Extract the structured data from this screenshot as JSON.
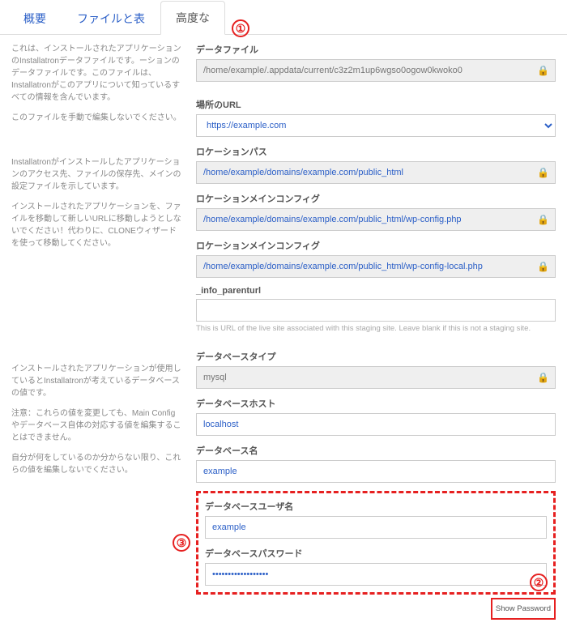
{
  "tabs": {
    "overview": "概要",
    "files": "ファイルと表",
    "advanced": "高度な"
  },
  "annotations": {
    "a1": "①",
    "a2": "②",
    "a3": "③"
  },
  "sidebar": {
    "block1": {
      "p1": "これは、インストールされたアプリケーションのInstallatronデータファイルです。ーションのデータファイルです。このファイルは、Installatronがこのアプリについて知っているすべての情報を含んでいます。",
      "p2": "このファイルを手動で編集しないでください。"
    },
    "block2": {
      "p1": "Installatronがインストールしたアプリケーションのアクセス先、ファイルの保存先、メインの設定ファイルを示しています。",
      "p2": "インストールされたアプリケーションを、ファイルを移動して新しいURLに移動しようとしないでください！代わりに、CLONEウィザードを使って移動してください。"
    },
    "block3": {
      "p1": "インストールされたアプリケーションが使用しているとInstallatronが考えているデータベースの値です。",
      "p2": "注意：これらの値を変更しても、Main Configやデータベース自体の対応する値を編集することはできません。",
      "p3": "自分が何をしているのか分からない限り、これらの値を編集しないでください。"
    }
  },
  "fields": {
    "datafile_label": "データファイル",
    "datafile_value": "/home/example/.appdata/current/c3z2m1up6wgso0ogow0kwoko0",
    "url_label": "場所のURL",
    "url_value": "https://example.com",
    "locpath_label": "ロケーションパス",
    "locpath_value": "/home/example/domains/example.com/public_html",
    "locmain1_label": "ロケーションメインコンフィグ",
    "locmain1_value": "/home/example/domains/example.com/public_html/wp-config.php",
    "locmain2_label": "ロケーションメインコンフィグ",
    "locmain2_value": "/home/example/domains/example.com/public_html/wp-config-local.php",
    "parenturl_label": "_info_parenturl",
    "parenturl_help": "This is URL of the live site associated with this staging site. Leave blank if this is not a staging site.",
    "dbtype_label": "データベースタイプ",
    "dbtype_value": "mysql",
    "dbhost_label": "データベースホスト",
    "dbhost_value": "localhost",
    "dbname_label": "データベース名",
    "dbname_value": "example",
    "dbuser_label": "データベースユーザ名",
    "dbuser_value": "example",
    "dbpass_label": "データベースパスワード",
    "dbpass_value": "••••••••••••••••••",
    "showpw_label": "Show Password"
  }
}
